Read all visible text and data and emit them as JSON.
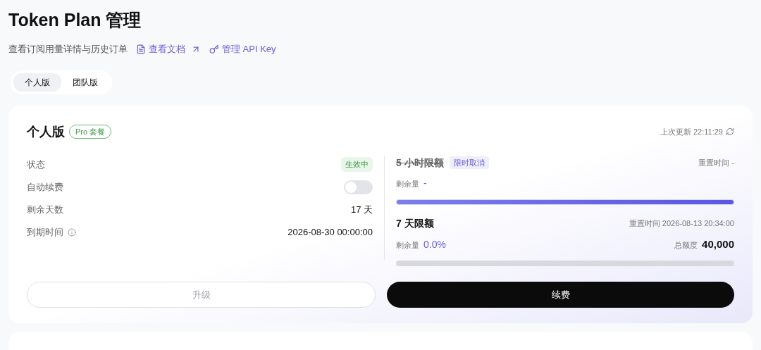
{
  "header": {
    "title": "Token Plan 管理",
    "subtitle": "查看订阅用量详情与历史订单",
    "links": [
      {
        "kind": "docs",
        "label": "查看文档",
        "external": true
      },
      {
        "kind": "key",
        "label": "管理 API Key",
        "external": false
      }
    ]
  },
  "tabs": [
    {
      "label": "个人版",
      "selected": true
    },
    {
      "label": "团队版",
      "selected": false
    }
  ],
  "plan": {
    "title": "个人版",
    "badge": "Pro 套餐",
    "updated_label": "上次更新",
    "updated_time": "22:11:29",
    "details": [
      {
        "kind": "status",
        "label": "状态",
        "value": "生效中"
      },
      {
        "kind": "toggle",
        "label": "自动续费",
        "on": false
      },
      {
        "kind": "text",
        "label": "剩余天数",
        "value": "17 天"
      },
      {
        "kind": "text",
        "label": "到期时间",
        "value": "2026-08-30 00:00:00",
        "info": true
      }
    ],
    "quotas": [
      {
        "title": "5 小时限额",
        "cancelled": true,
        "tag": "限时取消",
        "reset_label": "重置时间",
        "reset_value": "-",
        "remaining_label": "剩余量",
        "remaining_value": "-",
        "level": 1
      },
      {
        "title": "7 天限额",
        "cancelled": false,
        "reset_label": "重置时间",
        "reset_value": "2026-08-13 20:34:00",
        "remaining_label": "剩余量",
        "remaining_value": "0.0%",
        "total_label": "总额度",
        "total_value": "40,000",
        "level": 0
      }
    ],
    "buttons": [
      {
        "label": "升级",
        "kind": "secondary",
        "disabled": true
      },
      {
        "label": "续费",
        "kind": "primary",
        "disabled": false
      }
    ]
  }
}
